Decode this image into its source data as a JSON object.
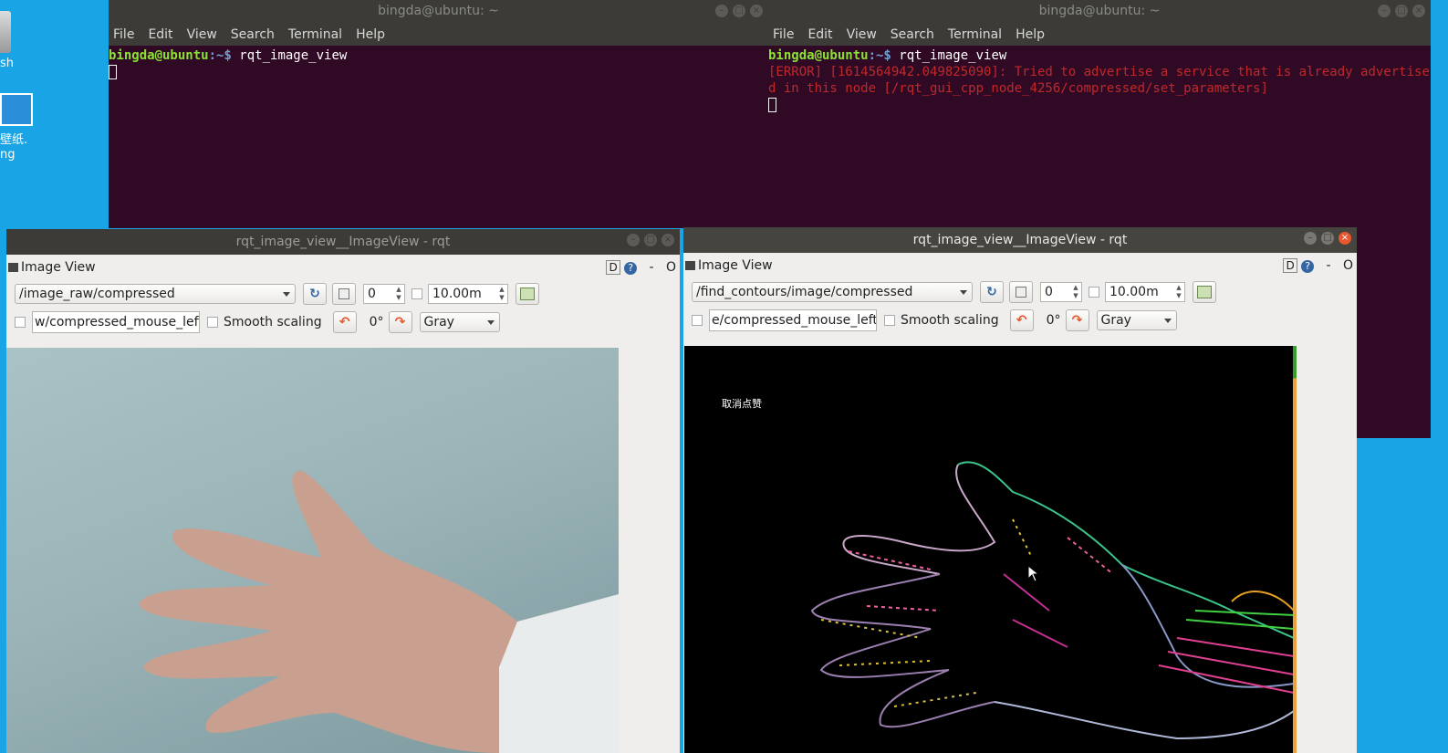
{
  "desktop": {
    "trash_label": "sh",
    "wallpaper_label_1": "壁纸.",
    "wallpaper_label_2": "ng"
  },
  "terminal_left": {
    "title": "bingda@ubuntu: ~",
    "menu": [
      "File",
      "Edit",
      "View",
      "Search",
      "Terminal",
      "Help"
    ],
    "prompt_user": "bingda@ubuntu",
    "prompt_path": ":~$",
    "command": " rqt_image_view"
  },
  "terminal_right": {
    "title": "bingda@ubuntu: ~",
    "menu": [
      "File",
      "Edit",
      "View",
      "Search",
      "Terminal",
      "Help"
    ],
    "prompt_user": "bingda@ubuntu",
    "prompt_path": ":~$",
    "command": " rqt_image_view",
    "error": "[ERROR] [1614564942.049825090]: Tried to advertise a service that is already advertised in this node [/rqt_gui_cpp_node_4256/compressed/set_parameters]"
  },
  "rqt_left": {
    "title": "rqt_image_view__ImageView - rqt",
    "pane_title": "Image View",
    "opts_d": "D",
    "opts_help": "?",
    "opts_min": "-",
    "opts_close": "O",
    "topic": "/image_raw/compressed",
    "spin_value": "0",
    "time_value": "10.00m",
    "mouse_topic": "w/compressed_mouse_left",
    "smooth_label": "Smooth scaling",
    "rotation": "0°",
    "color_scheme": "Gray"
  },
  "rqt_right": {
    "title": "rqt_image_view__ImageView - rqt",
    "pane_title": "Image View",
    "opts_d": "D",
    "opts_help": "?",
    "opts_min": "-",
    "opts_close": "O",
    "topic": "/find_contours/image/compressed",
    "spin_value": "0",
    "time_value": "10.00m",
    "mouse_topic": "e/compressed_mouse_left",
    "smooth_label": "Smooth scaling",
    "rotation": "0°",
    "color_scheme": "Gray",
    "overlay_text": "取消点赞"
  },
  "colors": {
    "desktop_bg": "#19a4e6",
    "terminal_bg": "#300a24",
    "prompt_user": "#8ae234",
    "prompt_path": "#729fcf",
    "error_text": "#c0282a"
  }
}
